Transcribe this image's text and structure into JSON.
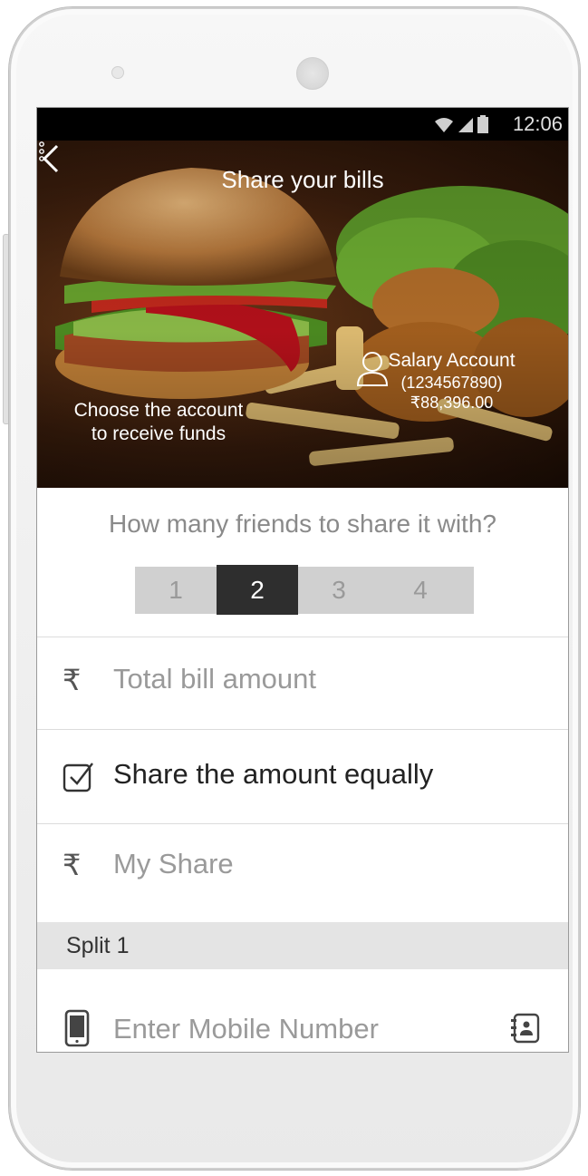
{
  "status_bar": {
    "time": "12:06"
  },
  "header": {
    "title": "Share your bills"
  },
  "hero": {
    "choose_line1": "Choose the account",
    "choose_line2": "to receive funds",
    "account_name": "Salary Account",
    "account_number": "(1234567890)",
    "account_balance": "₹88,396.00"
  },
  "friends": {
    "question": "How many  friends to share it with?",
    "options": [
      "1",
      "2",
      "3",
      "4"
    ],
    "selected": "2"
  },
  "form": {
    "currency_symbol": "₹",
    "total_placeholder": "Total bill amount",
    "share_equally_label": "Share the amount equally",
    "share_equally_checked": true,
    "my_share_placeholder": "My Share",
    "split_label": "Split 1",
    "mobile_placeholder": "Enter Mobile Number"
  }
}
